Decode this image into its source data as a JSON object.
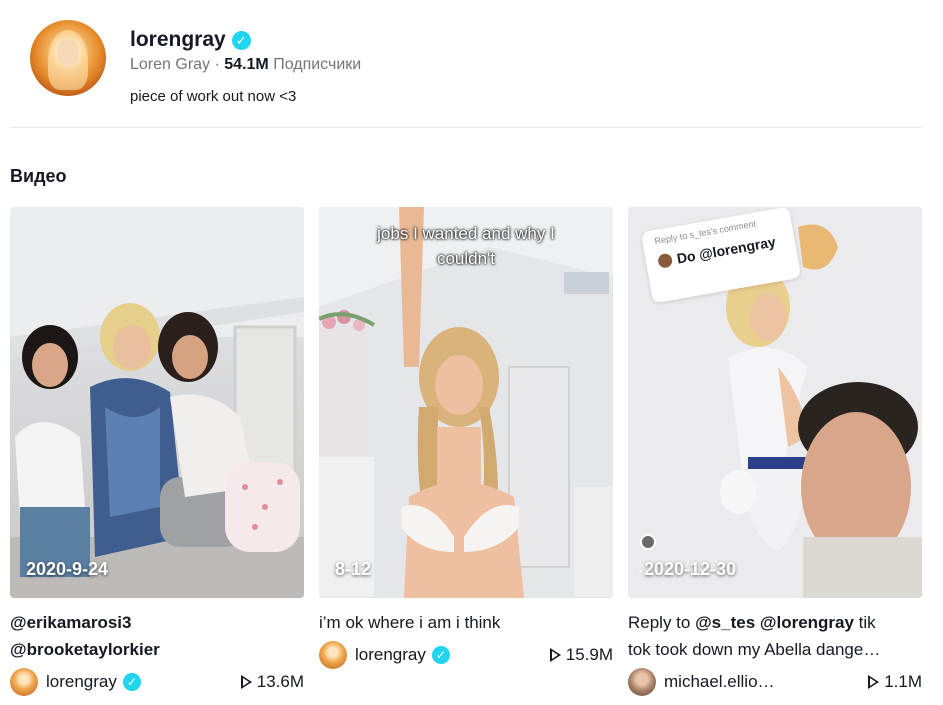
{
  "profile": {
    "username": "lorengray",
    "display_name": "Loren Gray",
    "separator": " · ",
    "followers_count": "54.1M",
    "followers_label": "Подписчики",
    "bio": "piece of work out now <3",
    "verified_icon": "check-icon"
  },
  "section": {
    "title": "Видео"
  },
  "videos": [
    {
      "date": "2020-9-24",
      "caption_line1": "@erikamarosi3",
      "caption_line2": "@brooketaylorkier",
      "author": "lorengray",
      "views": "13.6M"
    },
    {
      "date": "8-12",
      "overlay_line1": "jobs I wanted and why I",
      "overlay_line2": "couldn't",
      "caption": "i’m ok where i am i think",
      "author": "lorengray",
      "views": "15.9M"
    },
    {
      "date": "2020-12-30",
      "reply_bubble_header": "Reply to s_tes's comment",
      "reply_bubble_text": "Do @lorengray",
      "caption_prefix": "Reply to ",
      "caption_mention1": "@s_tes",
      "caption_space": " ",
      "caption_mention2": "@lorengray",
      "caption_rest": " tik",
      "caption_line2": "tok took down my Abella dange…",
      "author": "michael.ellio…",
      "views": "1.1M"
    }
  ],
  "colors": {
    "text": "#161823",
    "secondary": "#757575",
    "verified": "#20d5ec",
    "divider": "#e6e6e8"
  }
}
